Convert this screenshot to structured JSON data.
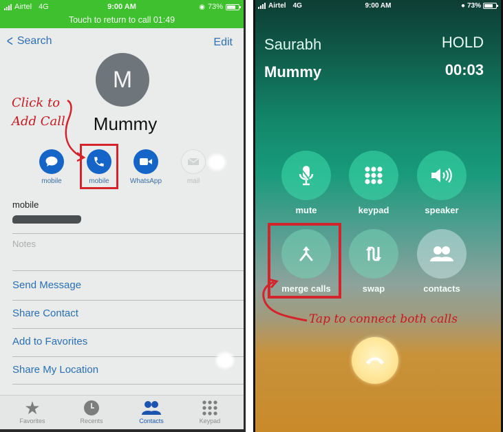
{
  "left_screen": {
    "status_bar": {
      "carrier": "Airtel",
      "network": "4G",
      "time": "9:00 AM",
      "battery": "73%",
      "battery_level_percent": 73
    },
    "return_banner": "Touch to return to call 01:49",
    "nav": {
      "back_label": "Search",
      "edit_label": "Edit"
    },
    "contact": {
      "initial": "M",
      "name": "Mummy"
    },
    "actions": [
      {
        "label": "mobile",
        "icon": "message-icon",
        "enabled": true
      },
      {
        "label": "mobile",
        "icon": "phone-icon",
        "enabled": true,
        "highlighted": true
      },
      {
        "label": "WhatsApp",
        "icon": "video-icon",
        "enabled": true
      },
      {
        "label": "mail",
        "icon": "mail-icon",
        "enabled": false
      }
    ],
    "phone_field": {
      "label": "mobile",
      "value_redacted": true
    },
    "notes_label": "Notes",
    "links": [
      "Send Message",
      "Share Contact",
      "Add to Favorites",
      "Share My Location"
    ],
    "tabs": [
      {
        "label": "Favorites",
        "icon": "star-icon",
        "active": false
      },
      {
        "label": "Recents",
        "icon": "clock-icon",
        "active": false
      },
      {
        "label": "Contacts",
        "icon": "contacts-icon",
        "active": true
      },
      {
        "label": "Keypad",
        "icon": "keypad-icon",
        "active": false
      }
    ],
    "annotation": [
      "Click to",
      "Add Call"
    ]
  },
  "right_screen": {
    "status_bar": {
      "carrier": "Airtel",
      "network": "4G",
      "time": "9:00 AM",
      "battery": "73%"
    },
    "calls": [
      {
        "name": "Saurabh",
        "status": "HOLD",
        "active": false
      },
      {
        "name": "Mummy",
        "status": "00:03",
        "active": true
      }
    ],
    "controls_row1": [
      {
        "label": "mute",
        "icon": "mute-icon"
      },
      {
        "label": "keypad",
        "icon": "keypad-icon"
      },
      {
        "label": "speaker",
        "icon": "speaker-icon"
      }
    ],
    "controls_row2": [
      {
        "label": "merge calls",
        "icon": "merge-icon",
        "highlighted": true
      },
      {
        "label": "swap",
        "icon": "swap-icon"
      },
      {
        "label": "contacts",
        "icon": "contacts-icon"
      }
    ],
    "end_call_icon": "end-call-icon",
    "annotation": "Tap to connect both calls"
  },
  "colors": {
    "green_banner": "#3fc12f",
    "ios_blue": "#1565c8",
    "annotation_red": "#d4232a"
  }
}
